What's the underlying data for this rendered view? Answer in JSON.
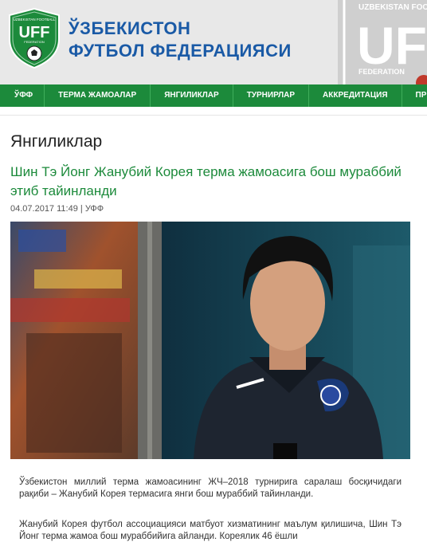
{
  "header": {
    "logo_text": "UFF",
    "logo_subtext": "UZBEKISTAN FOOTBALL",
    "logo_federation": "FEDERATION",
    "name_line1": "ЎЗБЕКИСТОН",
    "name_line2": "ФУТБОЛ ФЕДЕРАЦИЯСИ",
    "emblem_text": "UZBEKISTAN FOO",
    "emblem_letters": "UFF",
    "emblem_sub": "FEDERATION"
  },
  "nav": {
    "items": [
      "ЎФФ",
      "ТЕРМА ЖАМОАЛАР",
      "ЯНГИЛИКЛАР",
      "ТУРНИРЛАР",
      "АККРЕДИТАЦИЯ",
      "ПРЕСС-РЕ"
    ]
  },
  "page": {
    "section_title": "Янгиликлар"
  },
  "article": {
    "title": "Шин Тэ Йонг Жанубий Корея терма жамоасига бош мураббий этиб тайинланди",
    "date": "04.07.2017 11:49",
    "separator": "|",
    "source": "УФФ",
    "paragraph1": "Ўзбекистон миллий терма жамоасининг ЖЧ–2018 турнирига саралаш босқичидаги рақиби – Жанубий Корея термасига янги бош мураббий тайинланди.",
    "paragraph2": "Жанубий Корея футбол ассоциацияси матбуот хизматининг маълум қилишича, Шин Тэ Йонг терма жамоа бош мураббийига айланди. Кореялик 46 ёшли"
  },
  "colors": {
    "brand_green": "#1c8a3b",
    "brand_blue": "#1a5aa6"
  }
}
